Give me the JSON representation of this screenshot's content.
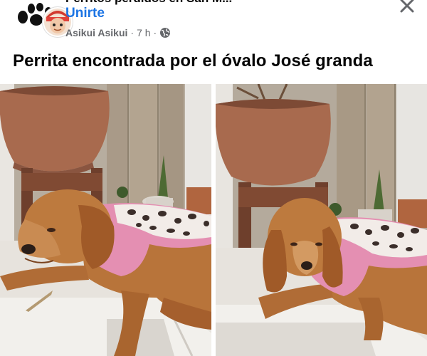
{
  "post": {
    "group_name": "Perritos perdidos en San M...",
    "join_label": "Unirte",
    "author": "Asikui Asikui",
    "separator": "·",
    "time": "7 h",
    "visibility": "globe-icon",
    "text": "Perrita encontrada por el óvalo José granda"
  },
  "photos": [
    {
      "name": "photo-dog-1"
    },
    {
      "name": "photo-dog-2"
    }
  ],
  "colors": {
    "link": "#1b74e4",
    "secondary_text": "#65676b",
    "dog_fur": "#b8743a",
    "sweater": "#e48fb2"
  }
}
